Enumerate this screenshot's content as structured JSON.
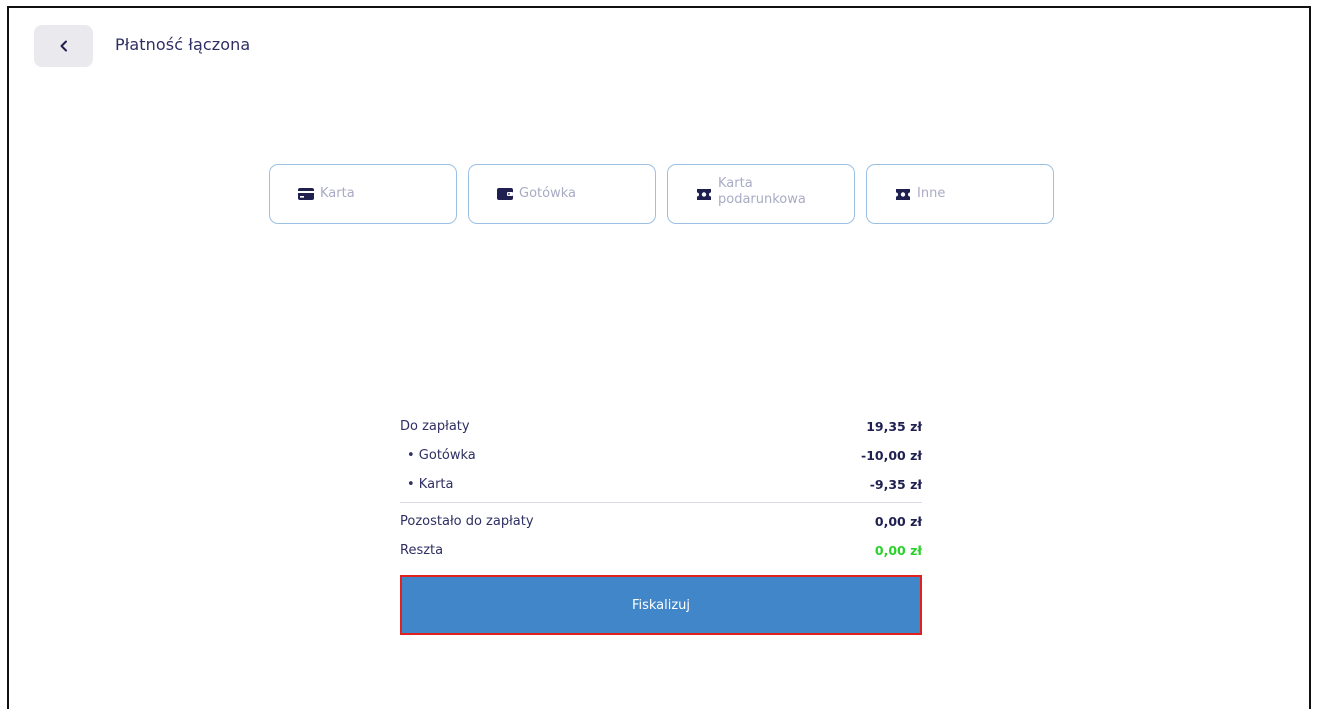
{
  "header": {
    "title": "Płatność łączona",
    "back_icon": "chevron-left-icon"
  },
  "payment_methods": [
    {
      "label": "Karta",
      "icon": "credit-card-icon"
    },
    {
      "label": "Gotówka",
      "icon": "wallet-icon"
    },
    {
      "label": "Karta\npodarunkowa",
      "icon": "ticket-icon"
    },
    {
      "label": "Inne",
      "icon": "ticket-icon"
    }
  ],
  "summary": {
    "to_pay_label": "Do zapłaty",
    "to_pay_value": "19,35 zł",
    "items": [
      {
        "label": "• Gotówka",
        "value": "-10,00 zł"
      },
      {
        "label": "• Karta",
        "value": "-9,35 zł"
      }
    ],
    "remaining_label": "Pozostało do zapłaty",
    "remaining_value": "0,00 zł",
    "change_label": "Reszta",
    "change_value": "0,00 zł"
  },
  "actions": {
    "fiscalize_label": "Fiskalizuj"
  },
  "colors": {
    "primary": "#4186c8",
    "text": "#2e2f63",
    "muted": "#a9abc4",
    "border": "#9cc0e4",
    "change_green": "#2bd12b",
    "highlight_red": "#e0221f",
    "icon_dark": "#1f2050"
  }
}
